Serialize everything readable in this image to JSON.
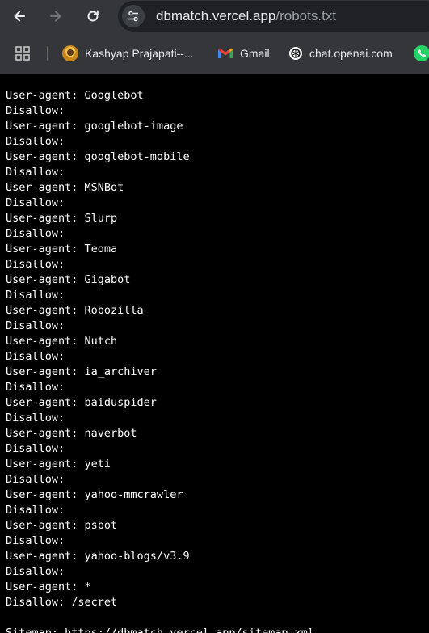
{
  "toolbar": {
    "url_host": "dbmatch.vercel.app",
    "url_path": "/robots.txt"
  },
  "bookmarks": [
    {
      "label": "Kashyap Prajapati--...",
      "icon": "avatar-icon"
    },
    {
      "label": "Gmail",
      "icon": "gmail-icon"
    },
    {
      "label": "chat.openai.com",
      "icon": "openai-icon"
    },
    {
      "label": "",
      "icon": "whatsapp-icon"
    }
  ],
  "robots_lines": [
    "User-agent: Googlebot",
    "Disallow:",
    "User-agent: googlebot-image",
    "Disallow:",
    "User-agent: googlebot-mobile",
    "Disallow:",
    "User-agent: MSNBot",
    "Disallow:",
    "User-agent: Slurp",
    "Disallow:",
    "User-agent: Teoma",
    "Disallow:",
    "User-agent: Gigabot",
    "Disallow:",
    "User-agent: Robozilla",
    "Disallow:",
    "User-agent: Nutch",
    "Disallow:",
    "User-agent: ia_archiver",
    "Disallow:",
    "User-agent: baiduspider",
    "Disallow:",
    "User-agent: naverbot",
    "Disallow:",
    "User-agent: yeti",
    "Disallow:",
    "User-agent: yahoo-mmcrawler",
    "Disallow:",
    "User-agent: psbot",
    "Disallow:",
    "User-agent: yahoo-blogs/v3.9",
    "Disallow:",
    "User-agent: *",
    "Disallow: /secret",
    "",
    "Sitemap: https://dbmatch.vercel.app/sitemap.xml"
  ]
}
